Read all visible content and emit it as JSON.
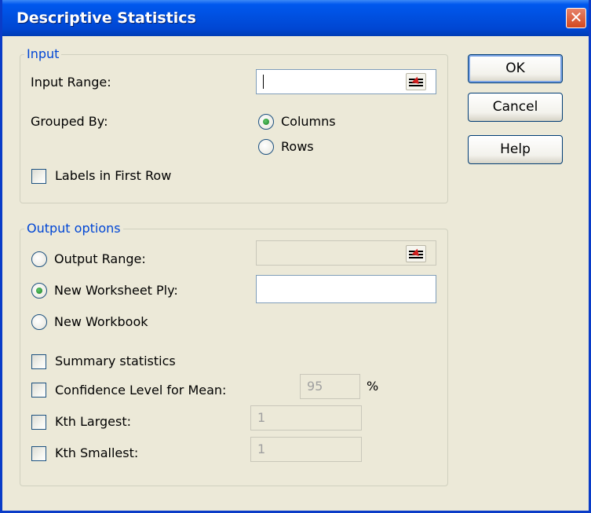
{
  "dialog": {
    "title": "Descriptive Statistics",
    "close_glyph": "✕"
  },
  "input": {
    "legend": "Input",
    "input_range_label": "Input Range:",
    "input_range_value": "",
    "grouped_by_label": "Grouped By:",
    "columns_label": "Columns",
    "columns_selected": true,
    "rows_label": "Rows",
    "rows_selected": false,
    "labels_first_row_label": "Labels in First Row",
    "labels_first_row_checked": false
  },
  "output": {
    "legend": "Output options",
    "output_range_label": "Output Range:",
    "output_range_value": "",
    "output_range_selected": false,
    "new_ply_label": "New Worksheet Ply:",
    "new_ply_value": "",
    "new_ply_selected": true,
    "new_workbook_label": "New Workbook",
    "new_workbook_selected": false,
    "summary_label": "Summary statistics",
    "summary_checked": false,
    "confidence_label": "Confidence Level for Mean:",
    "confidence_value": "95",
    "confidence_unit": "%",
    "confidence_checked": false,
    "kth_largest_label": "Kth Largest:",
    "kth_largest_value": "1",
    "kth_largest_checked": false,
    "kth_smallest_label": "Kth Smallest:",
    "kth_smallest_value": "1",
    "kth_smallest_checked": false
  },
  "buttons": {
    "ok": "OK",
    "cancel": "Cancel",
    "help": "Help"
  },
  "icons": {
    "range_picker": "range-picker-icon",
    "close": "close-icon"
  },
  "colors": {
    "titlebar": "#0054e3",
    "window_bg": "#ece9d8",
    "legend_text": "#0046d5",
    "close_button": "#d4481f"
  }
}
